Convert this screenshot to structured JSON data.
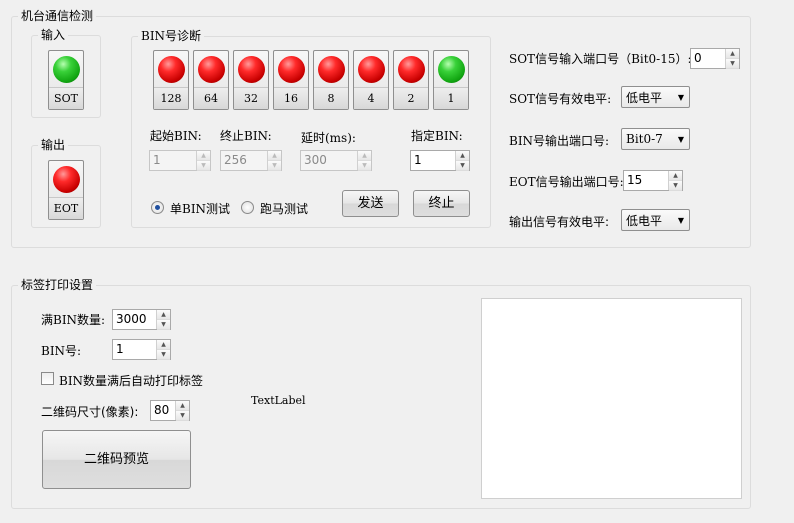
{
  "machine_group": {
    "title": "机台通信检测",
    "input": {
      "title": "输入",
      "lamp_label": "SOT",
      "lamp_color": "green"
    },
    "output": {
      "title": "输出",
      "lamp_label": "EOT",
      "lamp_color": "red"
    },
    "bin_diag": {
      "title": "BIN号诊断",
      "lamps": [
        {
          "label": "128",
          "color": "red"
        },
        {
          "label": "64",
          "color": "red"
        },
        {
          "label": "32",
          "color": "red"
        },
        {
          "label": "16",
          "color": "red"
        },
        {
          "label": "8",
          "color": "red"
        },
        {
          "label": "4",
          "color": "red"
        },
        {
          "label": "2",
          "color": "red"
        },
        {
          "label": "1",
          "color": "green"
        }
      ],
      "start_bin_label": "起始BIN:",
      "start_bin_value": "1",
      "end_bin_label": "终止BIN:",
      "end_bin_value": "256",
      "delay_label": "延时(ms):",
      "delay_value": "300",
      "specified_bin_label": "指定BIN:",
      "specified_bin_value": "1",
      "radio_single": "单BIN测试",
      "radio_run": "跑马测试",
      "send_button": "发送",
      "stop_button": "终止"
    },
    "sot_port_label": "SOT信号输入端口号（Bit0-15）:",
    "sot_port_value": "0",
    "sot_level_label": "SOT信号有效电平:",
    "sot_level_value": "低电平",
    "bin_port_label": "BIN号输出端口号:",
    "bin_port_value": "Bit0-7",
    "eot_port_label": "EOT信号输出端口号:",
    "eot_port_value": "15",
    "output_level_label": "输出信号有效电平:",
    "output_level_value": "低电平"
  },
  "label_group": {
    "title": "标签打印设置",
    "full_bin_label": "满BIN数量:",
    "full_bin_value": "3000",
    "bin_no_label": "BIN号:",
    "bin_no_value": "1",
    "auto_print_label": "BIN数量满后自动打印标签",
    "qr_size_label": "二维码尺寸(像素):",
    "qr_size_value": "80",
    "text_label": "TextLabel",
    "qr_preview_button": "二维码预览"
  },
  "colors": {
    "lamp_red": "#ff2a2a",
    "lamp_green": "#39d139",
    "radio_dot": "#1f4f9f"
  }
}
